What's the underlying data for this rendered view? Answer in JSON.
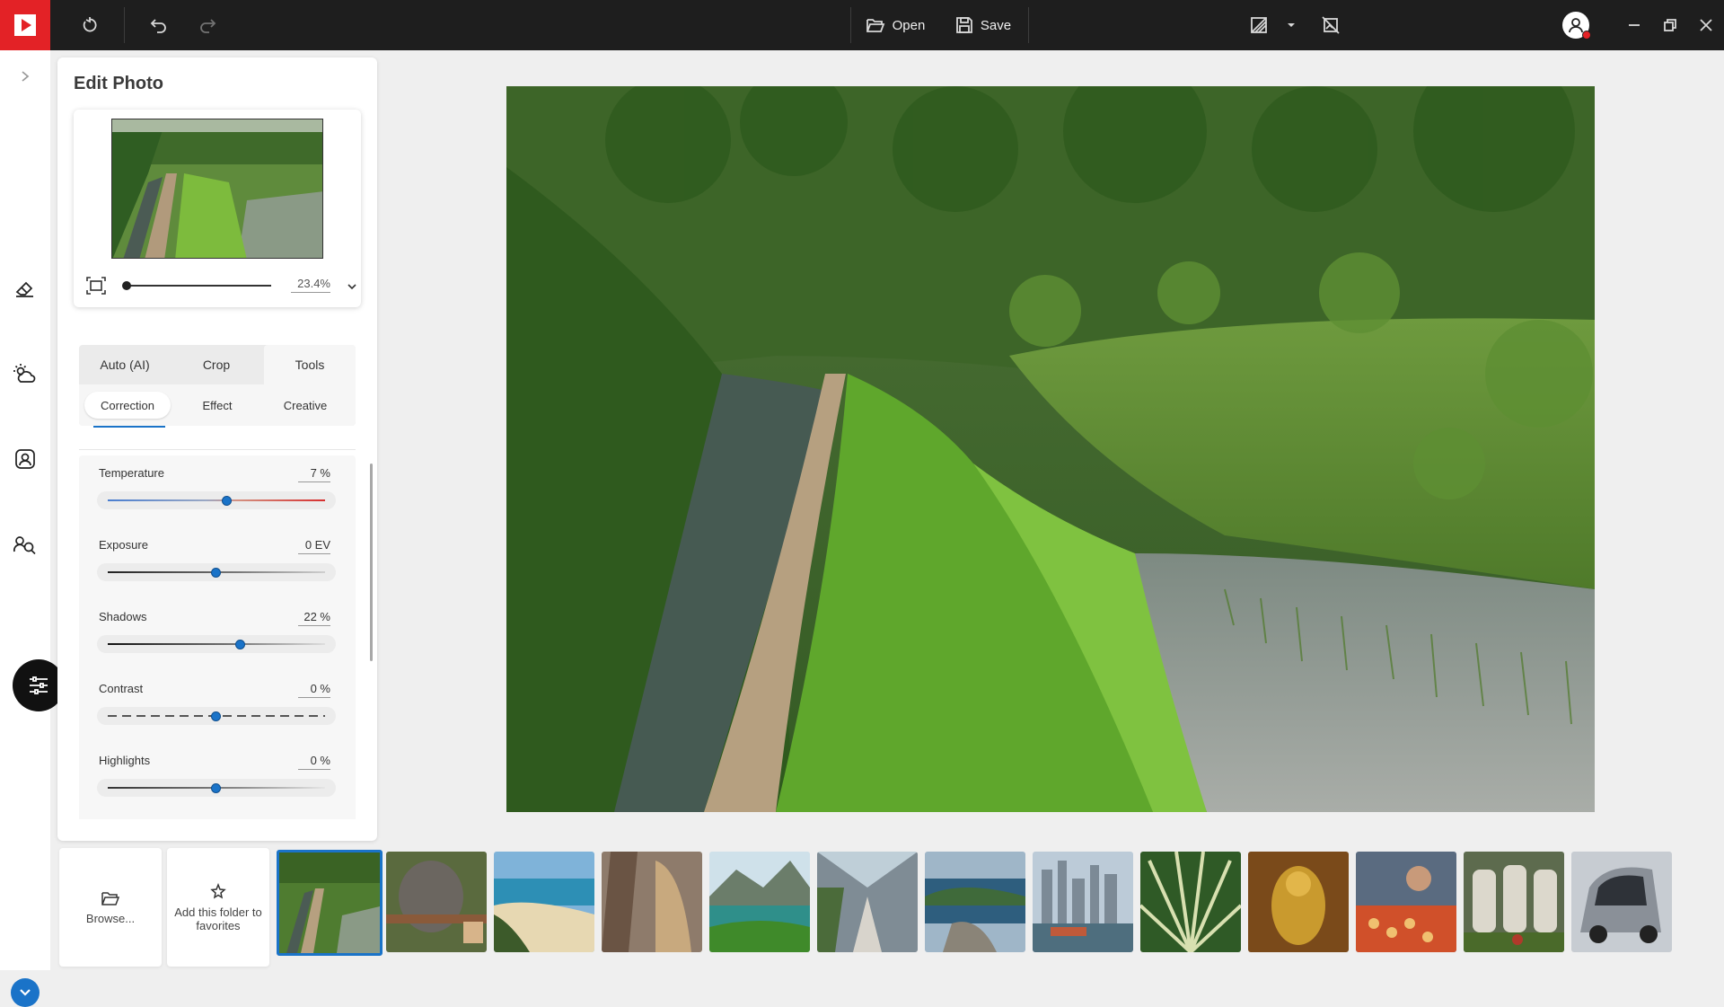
{
  "toolbar": {
    "open_label": "Open",
    "save_label": "Save"
  },
  "panel": {
    "title": "Edit Photo",
    "zoom_value": "23.4%",
    "tabs": [
      {
        "label": "Auto (AI)"
      },
      {
        "label": "Crop"
      },
      {
        "label": "Tools"
      }
    ],
    "subtabs": [
      {
        "label": "Correction"
      },
      {
        "label": "Effect"
      },
      {
        "label": "Creative"
      }
    ],
    "adjustments": [
      {
        "label": "Temperature",
        "value": "7 %",
        "level": 0.55
      },
      {
        "label": "Exposure",
        "value": "0 EV",
        "level": 0.5
      },
      {
        "label": "Shadows",
        "value": "22 %",
        "level": 0.61
      },
      {
        "label": "Contrast",
        "value": "0 %",
        "level": 0.5
      },
      {
        "label": "Highlights",
        "value": "0 %",
        "level": 0.5
      }
    ]
  },
  "filmstrip": {
    "browse_label": "Browse...",
    "favorite_label": "Add this folder to favorites",
    "thumbnails": [
      {
        "name": "rice-terrace",
        "selected": true
      },
      {
        "name": "elephant"
      },
      {
        "name": "beach-coast"
      },
      {
        "name": "cathedral-interior"
      },
      {
        "name": "mountain-lake"
      },
      {
        "name": "bridge-walkway"
      },
      {
        "name": "island-bay"
      },
      {
        "name": "city-skyline"
      },
      {
        "name": "agave-plant"
      },
      {
        "name": "golden-statue"
      },
      {
        "name": "street-food"
      },
      {
        "name": "war-graves"
      },
      {
        "name": "camper-van"
      }
    ]
  },
  "colors": {
    "accent": "#1a73c8",
    "brand": "#e32226",
    "topbar": "#1e1e1e"
  }
}
